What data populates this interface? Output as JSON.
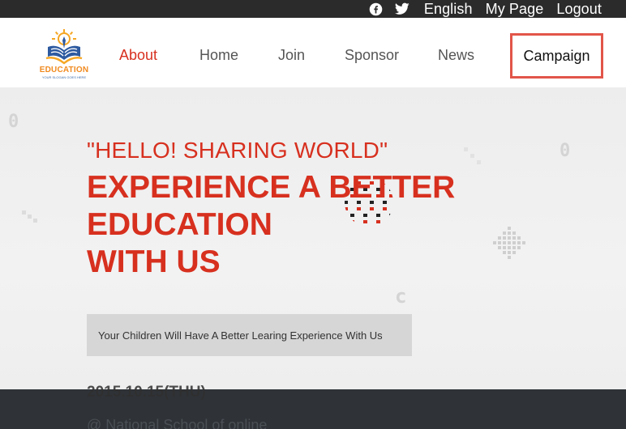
{
  "topbar": {
    "icons": [
      "facebook-icon",
      "twitter-icon"
    ],
    "links": [
      "English",
      "My Page",
      "Logout"
    ]
  },
  "logo": {
    "word": "EDUCATION",
    "tagline": "YOUR SLOGAN GOES HERE"
  },
  "nav": {
    "items": [
      "About",
      "Home",
      "Join",
      "Sponsor",
      "News"
    ],
    "active": "About",
    "campaign": "Campaign"
  },
  "hero": {
    "subtitle": "\"HELLO! SHARING WORLD\"",
    "title_lines": [
      "EXPERIENCE A BETTER",
      "EDUCATION",
      "WITH US"
    ],
    "cta": "Your Children Will Have A Better Learing Experience With Us",
    "date": "2015.10.15(THU)",
    "credit": "@ National School of online"
  },
  "colors": {
    "accent": "#d7301f",
    "topbar": "#2b2b2b",
    "highlight_border": "#e25549",
    "footer": "#2f3338"
  }
}
